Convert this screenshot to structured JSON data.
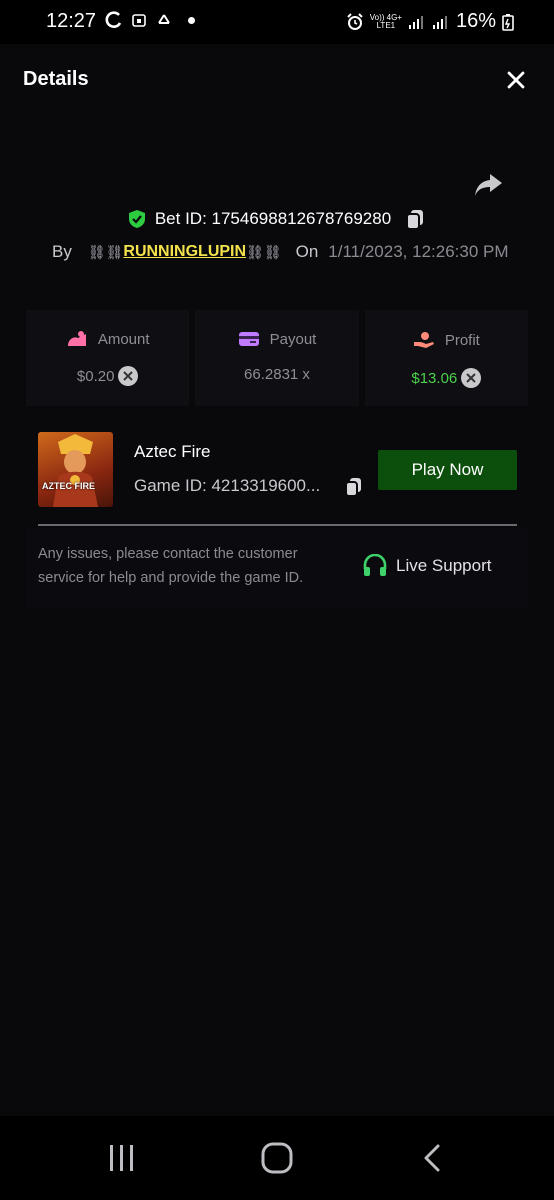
{
  "status_bar": {
    "time": "12:27",
    "battery": "16%",
    "network_top": "Vo)) 4G+",
    "network_bottom": "LTE1",
    "icons": [
      "sync-icon",
      "calendar-icon",
      "recycle-icon",
      "dot-icon",
      "alarm-icon",
      "signal-icon",
      "signal-icon",
      "battery-icon"
    ]
  },
  "header": {
    "title": "Details"
  },
  "bet": {
    "bet_id": "Bet ID: 1754698812678769280",
    "by_label": "By",
    "chain_left": "⛓⛓",
    "username": "RUNNINGLUPIN",
    "chain_right": "⛓⛓",
    "on_label": "On",
    "date": "1/11/2023, 12:26:30 PM"
  },
  "stats": {
    "amount": {
      "label": "Amount",
      "value": "$0.20"
    },
    "payout": {
      "label": "Payout",
      "value": "66.2831 x"
    },
    "profit": {
      "label": "Profit",
      "value": "$13.06"
    }
  },
  "game": {
    "name": "Aztec Fire",
    "game_id": "Game ID: 4213319600...",
    "play_label": "Play Now",
    "thumb_text": "AZTEC FIRE"
  },
  "help": {
    "text": "Any issues, please contact the customer service for help and provide the game ID.",
    "support_label": "Live Support"
  },
  "colors": {
    "accent_green": "#0c4f0c",
    "profit_green": "#4bd04b",
    "username_yellow": "#f3e24b",
    "shield_green": "#2ecc40",
    "icon_pink": "#ff6fa8",
    "icon_purple": "#c17bff",
    "icon_salmon": "#ff8a7a"
  }
}
